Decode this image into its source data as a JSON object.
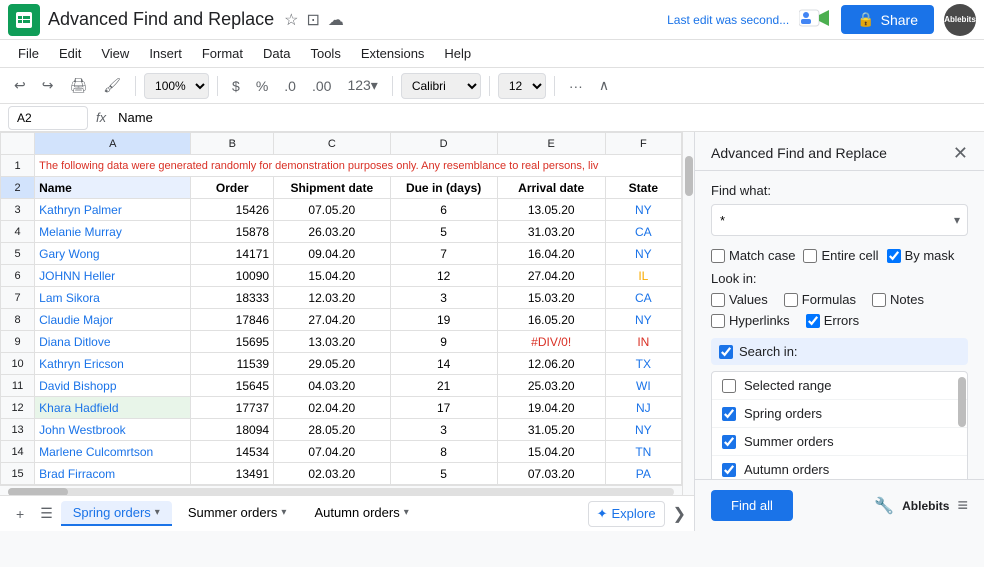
{
  "app": {
    "icon_label": "GS",
    "title": "Advanced Find and Replace",
    "last_edit": "Last edit was second...",
    "share_label": "Share",
    "avatar_label": "Ablebits",
    "zoom": "100%",
    "font": "Calibri",
    "font_size": "12"
  },
  "menu": {
    "items": [
      "File",
      "Edit",
      "View",
      "Insert",
      "Format",
      "Data",
      "Tools",
      "Extensions",
      "Help"
    ]
  },
  "formula_bar": {
    "cell_ref": "A2",
    "fx": "fx",
    "formula": "Name"
  },
  "sheet": {
    "notice": "The following data were generated randomly for demonstration purposes only. Any resemblance to real persons, liv",
    "col_headers": [
      "",
      "A",
      "B",
      "C",
      "D",
      "E",
      "F"
    ],
    "headers": [
      "Name",
      "Order",
      "Shipment date",
      "Due in (days)",
      "Arrival date",
      "State"
    ],
    "rows": [
      {
        "num": "3",
        "name": "Kathryn Palmer",
        "order": "15426",
        "ship": "07.05.20",
        "due": "6",
        "arrival": "13.05.20",
        "state": "NY",
        "state_class": "state-ny",
        "name_class": "name-col"
      },
      {
        "num": "4",
        "name": "Melanie Murray",
        "order": "15878",
        "ship": "26.03.20",
        "due": "5",
        "arrival": "31.03.20",
        "state": "CA",
        "state_class": "state-ca",
        "name_class": "name-col"
      },
      {
        "num": "5",
        "name": "Gary Wong",
        "order": "14171",
        "ship": "09.04.20",
        "due": "7",
        "arrival": "16.04.20",
        "state": "NY",
        "state_class": "state-ny",
        "name_class": "name-col"
      },
      {
        "num": "6",
        "name": "JOHNN Heller",
        "order": "10090",
        "ship": "15.04.20",
        "due": "12",
        "arrival": "27.04.20",
        "state": "IL",
        "state_class": "state-il",
        "name_class": "name-col"
      },
      {
        "num": "7",
        "name": "Lam Sikora",
        "order": "18333",
        "ship": "12.03.20",
        "due": "3",
        "arrival": "15.03.20",
        "state": "CA",
        "state_class": "state-ca",
        "name_class": "name-col"
      },
      {
        "num": "8",
        "name": "Claudie Major",
        "order": "17846",
        "ship": "27.04.20",
        "due": "19",
        "arrival": "16.05.20",
        "state": "NY",
        "state_class": "state-ny",
        "name_class": "name-col"
      },
      {
        "num": "9",
        "name": "Diana Ditlove",
        "order": "15695",
        "ship": "13.03.20",
        "due": "9",
        "arrival": "#DIV/0!",
        "state": "IN",
        "state_class": "state-in",
        "name_class": "name-col",
        "arrival_class": "err-cell"
      },
      {
        "num": "10",
        "name": "Kathryn Ericson",
        "order": "11539",
        "ship": "29.05.20",
        "due": "14",
        "arrival": "12.06.20",
        "state": "TX",
        "state_class": "state-tx",
        "name_class": "name-col"
      },
      {
        "num": "11",
        "name": "David Bishopp",
        "order": "15645",
        "ship": "04.03.20",
        "due": "21",
        "arrival": "25.03.20",
        "state": "WI",
        "state_class": "state-wi",
        "name_class": "name-col"
      },
      {
        "num": "12",
        "name": "Khara Hadfield",
        "order": "17737",
        "ship": "02.04.20",
        "due": "17",
        "arrival": "19.04.20",
        "state": "NJ",
        "state_class": "state-nj",
        "name_class": "name-col highlighted-name"
      },
      {
        "num": "13",
        "name": "John Westbrook",
        "order": "18094",
        "ship": "28.05.20",
        "due": "3",
        "arrival": "31.05.20",
        "state": "NY",
        "state_class": "state-ny",
        "name_class": "name-col"
      },
      {
        "num": "14",
        "name": "Marlene Culcomrtson",
        "order": "14534",
        "ship": "07.04.20",
        "due": "8",
        "arrival": "15.04.20",
        "state": "TN",
        "state_class": "state-tn",
        "name_class": "name-col"
      },
      {
        "num": "15",
        "name": "Brad Firracom",
        "order": "13491",
        "ship": "02.03.20",
        "due": "5",
        "arrival": "07.03.20",
        "state": "PA",
        "state_class": "state-pa",
        "name_class": "name-col"
      }
    ]
  },
  "tabs": {
    "items": [
      {
        "label": "Spring orders",
        "active": true
      },
      {
        "label": "Summer orders",
        "active": false
      },
      {
        "label": "Autumn orders",
        "active": false
      }
    ],
    "add_label": "+",
    "explore_label": "Explore",
    "chevron_label": "❯"
  },
  "panel": {
    "title": "Advanced Find and Replace",
    "close_label": "✕",
    "find_label": "Find what:",
    "find_value": "*",
    "find_placeholder": "*",
    "match_case_label": "Match case",
    "entire_cell_label": "Entire cell",
    "by_mask_label": "By mask",
    "look_in_label": "Look in:",
    "look_in_values": [
      "Values",
      "Formulas",
      "Notes"
    ],
    "look_in_row2": [
      "Hyperlinks",
      "Errors"
    ],
    "search_in_label": "Search in:",
    "search_in_items": [
      {
        "label": "Selected range",
        "checked": false
      },
      {
        "label": "Spring orders",
        "checked": true
      },
      {
        "label": "Summer orders",
        "checked": true
      },
      {
        "label": "Autumn orders",
        "checked": true
      }
    ],
    "find_all_label": "Find all",
    "ablebits_label": "Ablebits",
    "menu_icon": "≡"
  }
}
